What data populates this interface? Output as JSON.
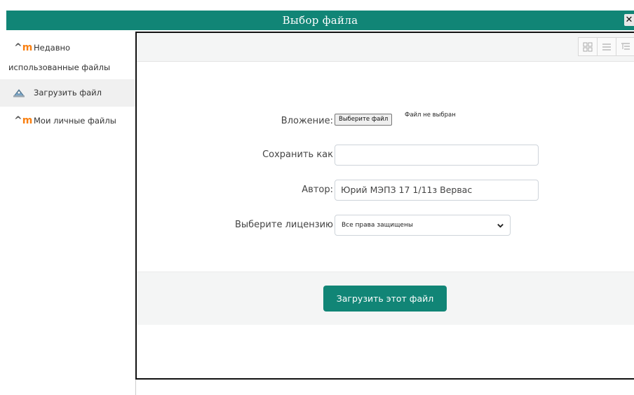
{
  "dialog": {
    "title": "Выбор файла",
    "close_label": "✕"
  },
  "sidebar": {
    "items": [
      {
        "label_line1": "Недавно",
        "label_line2": "использованные файлы",
        "icon": "moodle-icon",
        "active": false
      },
      {
        "label": "Загрузить файл",
        "icon": "upload-icon",
        "active": true
      },
      {
        "label": "Мои личные файлы",
        "icon": "moodle-icon",
        "active": false
      }
    ]
  },
  "toolbar": {
    "view_buttons": [
      "icons-view-icon",
      "list-view-icon",
      "tree-view-icon"
    ]
  },
  "form": {
    "attachment_label": "Вложение:",
    "file_button_label": "Выберите файл",
    "file_status": "Файл не выбран",
    "save_as_label": "Сохранить как",
    "save_as_value": "",
    "author_label": "Автор:",
    "author_value": "Юрий МЭПЗ 17 1/11з Вервас",
    "license_label": "Выберите лицензию",
    "license_selected": "Все права защищены",
    "submit_label": "Загрузить этот файл"
  },
  "colors": {
    "accent": "#118576",
    "toolbar_bg": "#f4f5f5",
    "moodle_orange": "#f98012"
  }
}
